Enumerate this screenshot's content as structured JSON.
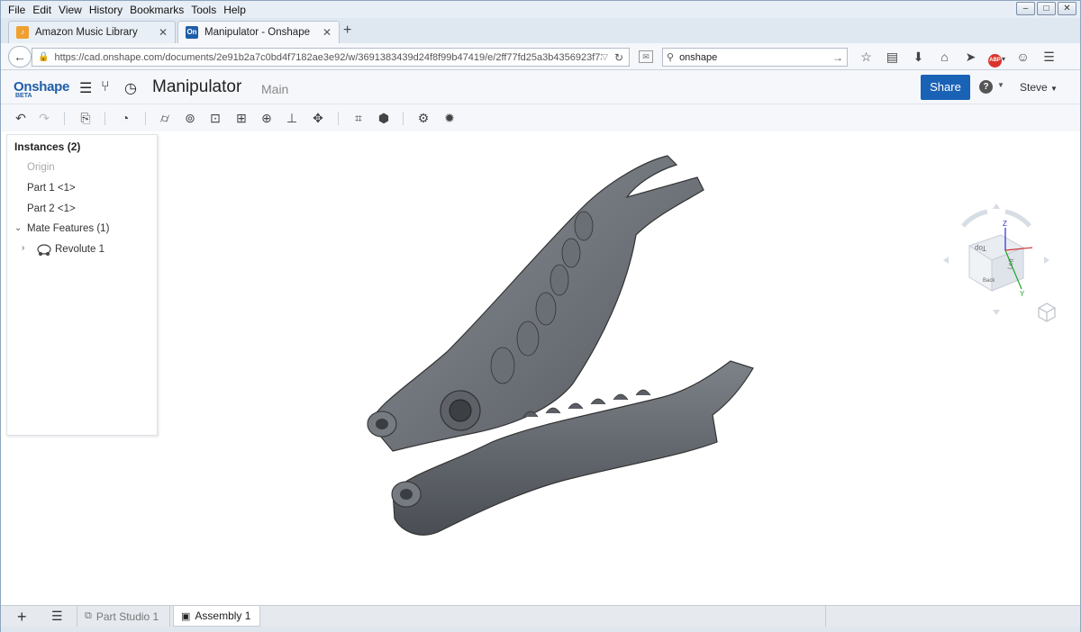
{
  "menu": [
    "File",
    "Edit",
    "View",
    "History",
    "Bookmarks",
    "Tools",
    "Help"
  ],
  "window_controls": {
    "minimize": "–",
    "maximize": "□",
    "close": "✕"
  },
  "browser_tabs": [
    {
      "label": "Amazon Music Library",
      "favicon": "music-icon",
      "active": false
    },
    {
      "label": "Manipulator - Onshape",
      "favicon_text": "On",
      "active": true
    }
  ],
  "new_tab_label": "+",
  "address": {
    "url": "https://cad.onshape.com/documents/2e91b2a7c0bd4f7182ae3e92/w/3691383439d24f8f99b47419/e/2ff77fd25a3b4356923f732e"
  },
  "search": {
    "value": "onshape"
  },
  "onshape": {
    "brand": "Onshape",
    "beta": "BETA",
    "document_title": "Manipulator",
    "workspace": "Main",
    "share_label": "Share",
    "help_label": "?",
    "user": "Steve"
  },
  "instances_panel": {
    "title": "Instances (2)",
    "origin": "Origin",
    "parts": [
      "Part 1 <1>",
      "Part 2 <1>"
    ],
    "mate_features": "Mate Features (1)",
    "mates": [
      "Revolute 1"
    ]
  },
  "view_cube": {
    "axis_z": "Z",
    "axis_y": "Y",
    "face_top": "Top",
    "face_left": "Left",
    "face_back": "Back"
  },
  "bottom_tabs": [
    {
      "label": "Part Studio 1",
      "active": false
    },
    {
      "label": "Assembly 1",
      "active": true
    }
  ],
  "colors": {
    "share_button": "#1a62b5",
    "onshape_blue": "#1f5ea8",
    "part_gray": "#6b7077"
  }
}
